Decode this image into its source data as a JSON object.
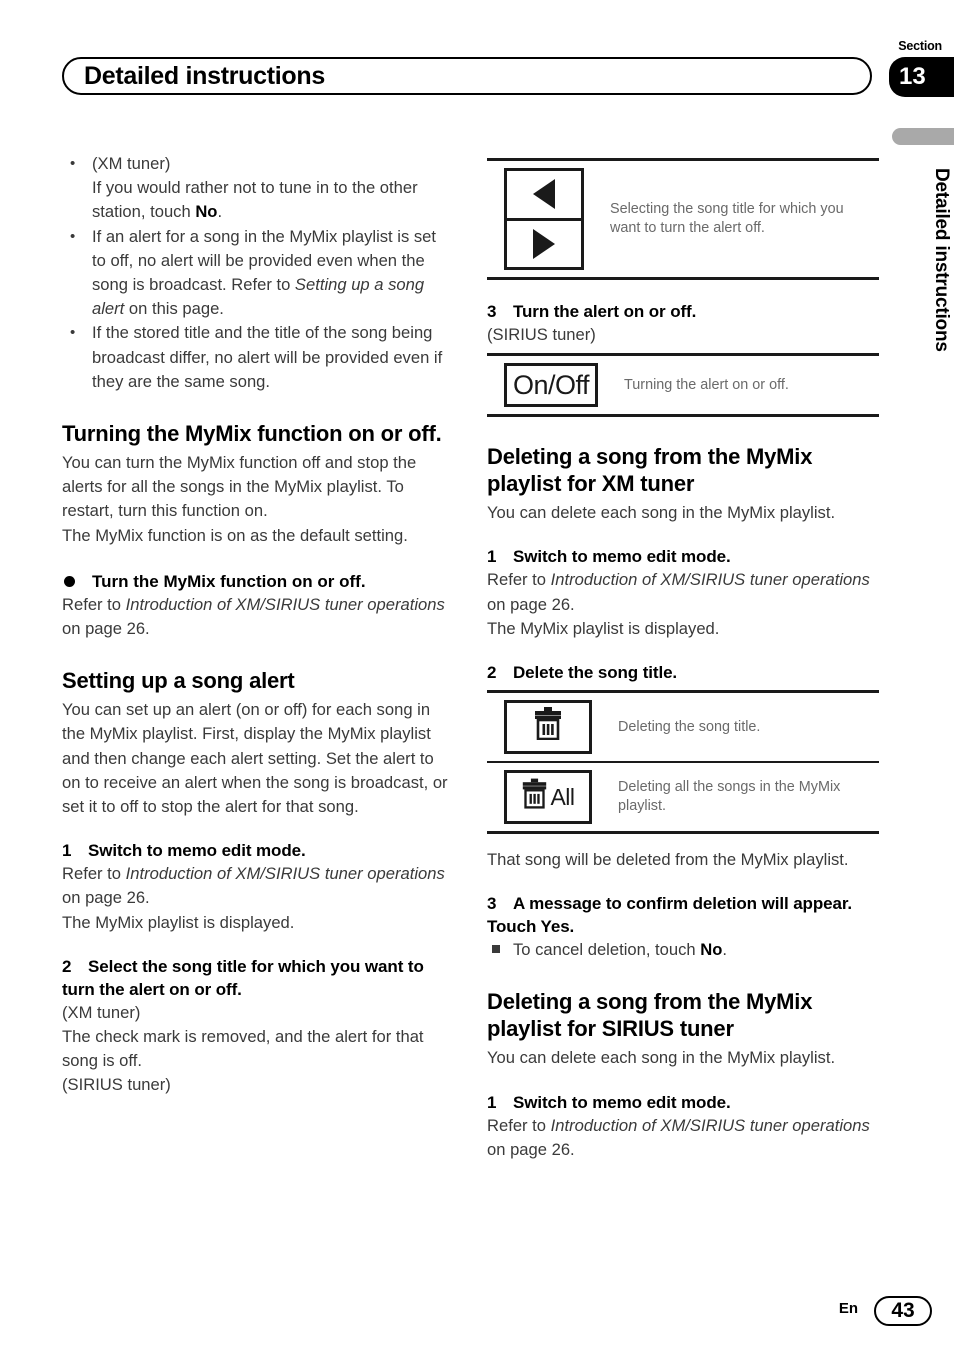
{
  "header": {
    "title": "Detailed instructions",
    "section_label": "Section",
    "section_number": "13"
  },
  "side": {
    "vertical_text": "Detailed instructions"
  },
  "left_column": {
    "notes": [
      {
        "line1": "(XM tuner)",
        "line2": "If you would rather not to tune in to the other station, touch ",
        "bold": "No",
        "line3": "."
      },
      {
        "text_a": "If an alert for a song in the MyMix playlist is set to off, no alert will be provided even when the song is broadcast. Refer to ",
        "italic": "Setting up a song alert",
        "text_b": " on this page."
      },
      {
        "text": "If the stored title and the title of the song being broadcast differ, no alert will be provided even if they are the same song."
      }
    ],
    "section1": {
      "heading": "Turning the MyMix function on or off.",
      "body": "You can turn the MyMix function off and stop the alerts for all the songs in the MyMix playlist. To restart, turn this function on.",
      "body2": "The MyMix function is on as the default setting.",
      "bullet_head": "Turn the MyMix function on or off.",
      "refer_prefix": "Refer to ",
      "refer_italic": "Introduction of XM/SIRIUS tuner operations",
      "refer_suffix": " on page 26."
    },
    "section2": {
      "heading": "Setting up a song alert",
      "body": "You can set up an alert (on or off) for each song in the MyMix playlist. First, display the MyMix playlist and then change each alert setting. Set the alert to on to receive an alert when the song is broadcast, or set it to off to stop the alert for that song.",
      "step1": {
        "num": "1",
        "title": "Switch to memo edit mode.",
        "refer_prefix": "Refer to ",
        "refer_italic": "Introduction of XM/SIRIUS tuner operations",
        "refer_suffix": " on page 26.",
        "result": "The MyMix playlist is displayed."
      },
      "step2": {
        "num": "2",
        "title": "Select the song title for which you want to turn the alert on or off.",
        "tuner_xm": "(XM tuner)",
        "result_xm": "The check mark is removed, and the alert for that song is off.",
        "tuner_sirius": "(SIRIUS tuner)"
      }
    }
  },
  "right_column": {
    "figure_arrows": {
      "icon_left": "left-triangle-icon",
      "icon_right": "right-triangle-icon",
      "caption": "Selecting the song title for which you want to turn the alert off."
    },
    "step3": {
      "num": "3",
      "title": "Turn the alert on or off.",
      "tuner": "(SIRIUS tuner)"
    },
    "figure_onoff": {
      "key_label": "On/Off",
      "caption": "Turning the alert on or off."
    },
    "section_xm": {
      "heading": "Deleting a song from the MyMix playlist for XM tuner",
      "body": "You can delete each song in the MyMix playlist.",
      "step1": {
        "num": "1",
        "title": "Switch to memo edit mode.",
        "refer_prefix": "Refer to ",
        "refer_italic": "Introduction of XM/SIRIUS tuner operations",
        "refer_suffix": " on page 26.",
        "result": "The MyMix playlist is displayed."
      },
      "step2": {
        "num": "2",
        "title": "Delete the song title."
      },
      "figure_delete": {
        "row1_icon": "trash-icon",
        "row1_caption": "Deleting the song title.",
        "row2_icon": "trash-all-icon",
        "row2_key_text": "All",
        "row2_caption": "Deleting all the songs in the MyMix playlist."
      },
      "result": "That song will be deleted from the MyMix playlist.",
      "step3": {
        "num": "3",
        "title": "A message to confirm deletion will appear. Touch Yes.",
        "note_prefix": "To cancel deletion, touch ",
        "note_bold": "No",
        "note_suffix": "."
      }
    },
    "section_sirius": {
      "heading": "Deleting a song from the MyMix playlist for SIRIUS tuner",
      "body": "You can delete each song in the MyMix playlist.",
      "step1": {
        "num": "1",
        "title": "Switch to memo edit mode.",
        "refer_prefix": "Refer to ",
        "refer_italic": "Introduction of XM/SIRIUS tuner operations",
        "refer_suffix": " on page 26."
      }
    }
  },
  "footer": {
    "language": "En",
    "page_number": "43"
  }
}
